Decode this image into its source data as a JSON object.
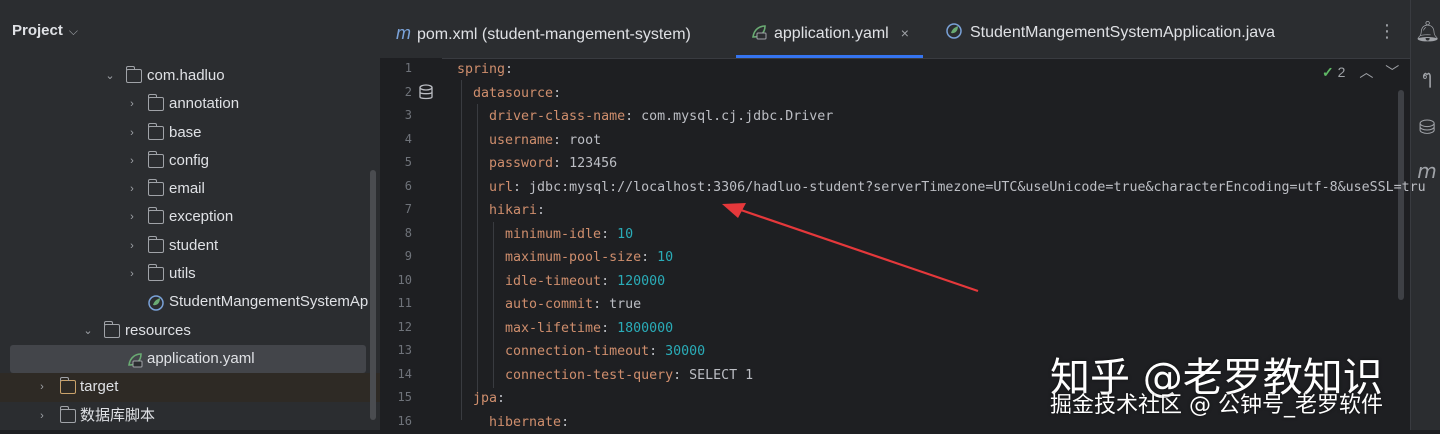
{
  "project": {
    "title": "Project",
    "tree": [
      {
        "label": "com.hadluo",
        "type": "package",
        "expanded": true
      },
      {
        "label": "annotation",
        "type": "package",
        "expanded": false
      },
      {
        "label": "base",
        "type": "package",
        "expanded": false
      },
      {
        "label": "config",
        "type": "package",
        "expanded": false
      },
      {
        "label": "email",
        "type": "package",
        "expanded": false
      },
      {
        "label": "exception",
        "type": "package",
        "expanded": false
      },
      {
        "label": "student",
        "type": "package",
        "expanded": false
      },
      {
        "label": "utils",
        "type": "package",
        "expanded": false
      },
      {
        "label": "StudentMangementSystemAp",
        "type": "spring-class"
      },
      {
        "label": "resources",
        "type": "resources-folder",
        "expanded": true
      },
      {
        "label": "application.yaml",
        "type": "yaml-file",
        "selected": true
      },
      {
        "label": "target",
        "type": "folder",
        "expanded": false
      },
      {
        "label": "数据库脚本",
        "type": "folder",
        "expanded": false
      }
    ]
  },
  "tabs": [
    {
      "label": "pom.xml (student-mangement-system)",
      "icon": "maven-icon"
    },
    {
      "label": "application.yaml",
      "icon": "yaml-leaf-icon",
      "active": true,
      "close": "×"
    },
    {
      "label": "StudentMangementSystemApplication.java",
      "icon": "spring-class-icon"
    }
  ],
  "editor": {
    "inspection_count": "2",
    "lines": [
      {
        "n": "1",
        "key": "spring",
        "sep": ":",
        "val": ""
      },
      {
        "n": "2",
        "key": "datasource",
        "sep": ":",
        "val": ""
      },
      {
        "n": "3",
        "key": "driver-class-name",
        "sep": ": ",
        "val": "com.mysql.cj.jdbc.Driver"
      },
      {
        "n": "4",
        "key": "username",
        "sep": ": ",
        "val": "root"
      },
      {
        "n": "5",
        "key": "password",
        "sep": ": ",
        "val": "123456"
      },
      {
        "n": "6",
        "key": "url",
        "sep": ": ",
        "val": "jdbc:mysql://localhost:3306/hadluo-student?serverTimezone=UTC&useUnicode=true&characterEncoding=utf-8&useSSL=tru"
      },
      {
        "n": "7",
        "key": "hikari",
        "sep": ":",
        "val": ""
      },
      {
        "n": "8",
        "key": "minimum-idle",
        "sep": ": ",
        "val": "10",
        "num": true
      },
      {
        "n": "9",
        "key": "maximum-pool-size",
        "sep": ": ",
        "val": "10",
        "num": true
      },
      {
        "n": "10",
        "key": "idle-timeout",
        "sep": ": ",
        "val": "120000",
        "num": true
      },
      {
        "n": "11",
        "key": "auto-commit",
        "sep": ": ",
        "val": "true"
      },
      {
        "n": "12",
        "key": "max-lifetime",
        "sep": ": ",
        "val": "1800000",
        "num": true
      },
      {
        "n": "13",
        "key": "connection-timeout",
        "sep": ": ",
        "val": "30000",
        "num": true
      },
      {
        "n": "14",
        "key": "connection-test-query",
        "sep": ": ",
        "val": "SELECT 1"
      },
      {
        "n": "15",
        "key": "jpa",
        "sep": ":",
        "val": ""
      },
      {
        "n": "16",
        "key": "hibernate",
        "sep": ":",
        "val": ""
      }
    ]
  },
  "watermark": {
    "line1": "知乎 @老罗教知识",
    "line2": "掘金技术社区 @ 公钟号_老罗软件"
  },
  "colors": {
    "accent": "#3574f0",
    "key": "#cf8e6d",
    "number": "#2aacb8",
    "arrow": "#e5383b"
  }
}
